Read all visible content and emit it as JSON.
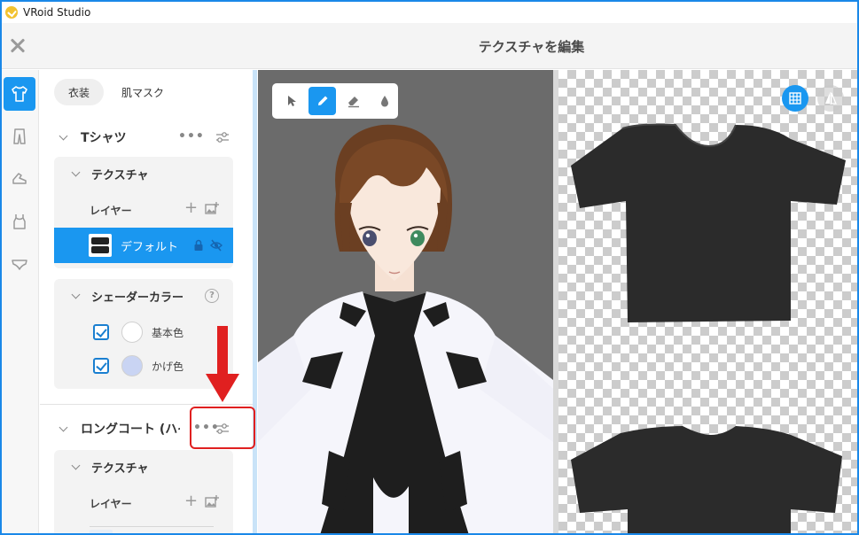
{
  "window": {
    "title": "VRoid Studio"
  },
  "header": {
    "title": "テクスチャを編集"
  },
  "rail": {
    "items": [
      {
        "icon": "shirt-icon",
        "active": true
      },
      {
        "icon": "pants-icon",
        "active": false
      },
      {
        "icon": "shoe-icon",
        "active": false
      },
      {
        "icon": "tanktop-icon",
        "active": false
      },
      {
        "icon": "underwear-icon",
        "active": false
      }
    ]
  },
  "panel": {
    "tabs": [
      {
        "label": "衣装",
        "active": true
      },
      {
        "label": "肌マスク",
        "active": false
      }
    ],
    "sections": [
      {
        "title": "Tシャツ",
        "more": "•••",
        "texture": {
          "title": "テクスチャ",
          "layer_label": "レイヤー",
          "add_symbol": "+",
          "layers": [
            {
              "name": "デフォルト",
              "selected": true
            }
          ]
        },
        "shader": {
          "title": "シェーダーカラー",
          "help": "?",
          "colors": [
            {
              "label": "基本色",
              "checked": true,
              "color": "#ffffff"
            },
            {
              "label": "かげ色",
              "checked": true,
              "color": "#c9d4f3"
            }
          ]
        }
      },
      {
        "title": "ロングコート (ハイ",
        "more": "•••",
        "texture": {
          "title": "テクスチャ",
          "layer_label": "レイヤー",
          "add_symbol": "+"
        }
      }
    ]
  },
  "viewport": {
    "tools": [
      {
        "icon": "cursor-icon",
        "active": false
      },
      {
        "icon": "pen-icon",
        "active": true
      },
      {
        "icon": "eraser-icon",
        "active": false
      },
      {
        "icon": "fill-drop-icon",
        "active": false
      }
    ]
  },
  "colors": {
    "accent": "#1a97f0",
    "annotation_red": "#e02020"
  }
}
